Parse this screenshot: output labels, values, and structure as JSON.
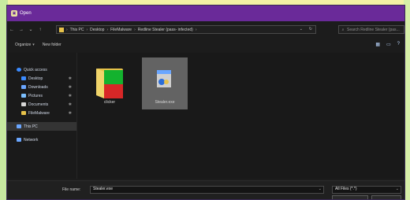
{
  "window": {
    "title": "Open"
  },
  "nav": {
    "back": "←",
    "forward": "→",
    "up": "↑",
    "path": [
      "This PC",
      "Desktop",
      "FileMalware",
      "Redline Stealer (pass- infected)"
    ],
    "addr_dropdown": "⌄",
    "refresh": "↻",
    "search_placeholder": "Search Redline Stealer (pas..."
  },
  "toolbar": {
    "organize": "Organize",
    "new_folder": "New folder"
  },
  "sidebar": {
    "items": [
      {
        "label": "Quick access",
        "icon": "star-icon",
        "color": "#3b8bff",
        "pinned": false
      },
      {
        "label": "Desktop",
        "icon": "desktop-icon",
        "color": "#3b8bff",
        "pinned": true
      },
      {
        "label": "Downloads",
        "icon": "download-icon",
        "color": "#6aa6ff",
        "pinned": true
      },
      {
        "label": "Pictures",
        "icon": "pictures-icon",
        "color": "#7cc0ff",
        "pinned": true
      },
      {
        "label": "Documents",
        "icon": "documents-icon",
        "color": "#d7d7d7",
        "pinned": true
      },
      {
        "label": "FileMalware",
        "icon": "folder-icon",
        "color": "#e7c24a",
        "pinned": true
      },
      {
        "label": "This PC",
        "icon": "pc-icon",
        "color": "#6aa6ff",
        "pinned": false,
        "selected": true
      },
      {
        "label": "Network",
        "icon": "network-icon",
        "color": "#6aa6ff",
        "pinned": false
      }
    ]
  },
  "files": [
    {
      "label": "clicker",
      "type": "folder"
    },
    {
      "label": "Stealer.exe",
      "type": "exe",
      "selected": true
    }
  ],
  "bottom": {
    "file_name_label": "File name:",
    "file_name_value": "Stealer.exe",
    "filter_value": "All Files (*.*)",
    "open_label": "",
    "cancel_label": ""
  },
  "colors": {
    "titlebar": "#6a2a99",
    "window": "#1c1c1c",
    "selected_tile": "#636363",
    "folder_yellow": "#e7c24a",
    "folder_green": "#13b22e",
    "folder_red": "#d82727"
  }
}
